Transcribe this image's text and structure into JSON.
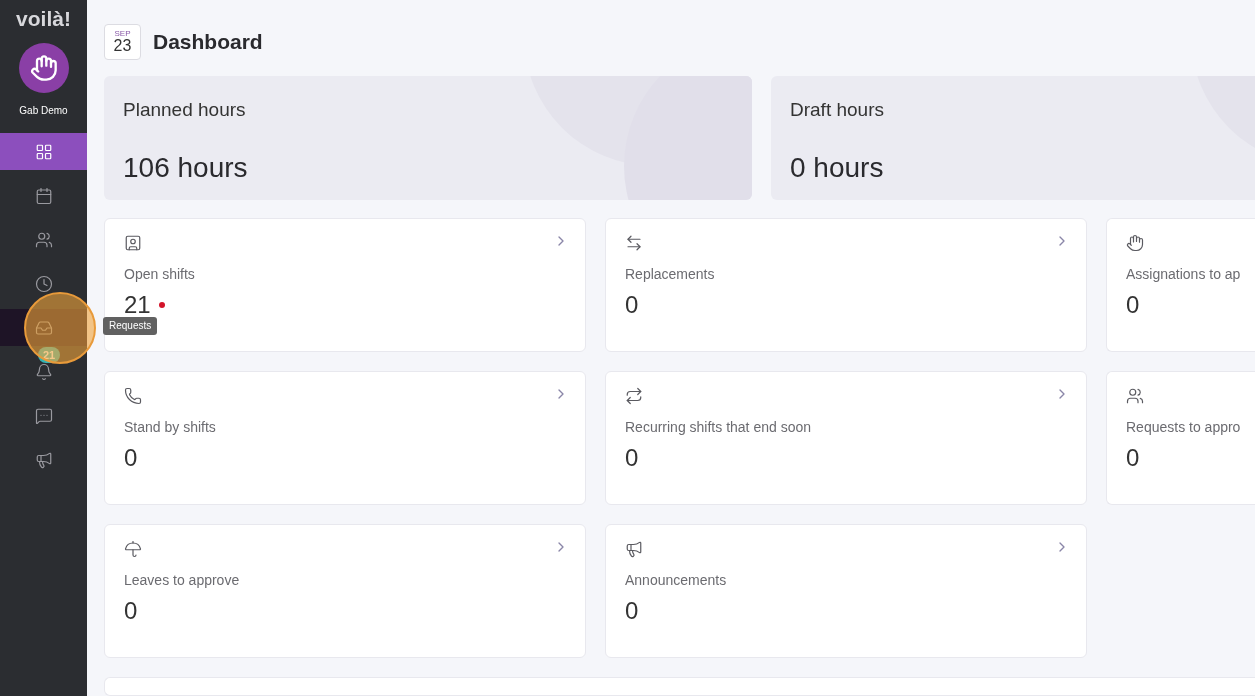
{
  "sidebar": {
    "logo": "voilà!",
    "user": "Gab Demo",
    "items": [
      {
        "selected": true,
        "hovered": false
      },
      {
        "selected": false,
        "hovered": false
      },
      {
        "selected": false,
        "hovered": false
      },
      {
        "selected": false,
        "hovered": false
      },
      {
        "selected": false,
        "hovered": true,
        "tooltip": "Requests"
      },
      {
        "selected": false,
        "hovered": false,
        "badge": "21"
      },
      {
        "selected": false,
        "hovered": false
      },
      {
        "selected": false,
        "hovered": false
      }
    ]
  },
  "header": {
    "date": {
      "month": "SEP",
      "day": "23"
    },
    "title": "Dashboard"
  },
  "hours": [
    {
      "label": "Planned hours",
      "value": "106 hours"
    },
    {
      "label": "Draft hours",
      "value": "0 hours"
    }
  ],
  "cards": [
    {
      "label": "Open shifts",
      "value": "21",
      "alert": true,
      "arrow": true
    },
    {
      "label": "Replacements",
      "value": "0",
      "alert": false,
      "arrow": true
    },
    {
      "label": "Assignations to ap",
      "value": "0",
      "alert": false,
      "arrow": false
    },
    {
      "label": "Stand by shifts",
      "value": "0",
      "alert": false,
      "arrow": true
    },
    {
      "label": "Recurring shifts that end soon",
      "value": "0",
      "alert": false,
      "arrow": true
    },
    {
      "label": "Requests to appro",
      "value": "0",
      "alert": false,
      "arrow": false
    },
    {
      "label": "Leaves to approve",
      "value": "0",
      "alert": false,
      "arrow": true
    },
    {
      "label": "Announcements",
      "value": "0",
      "alert": false,
      "arrow": true
    }
  ]
}
